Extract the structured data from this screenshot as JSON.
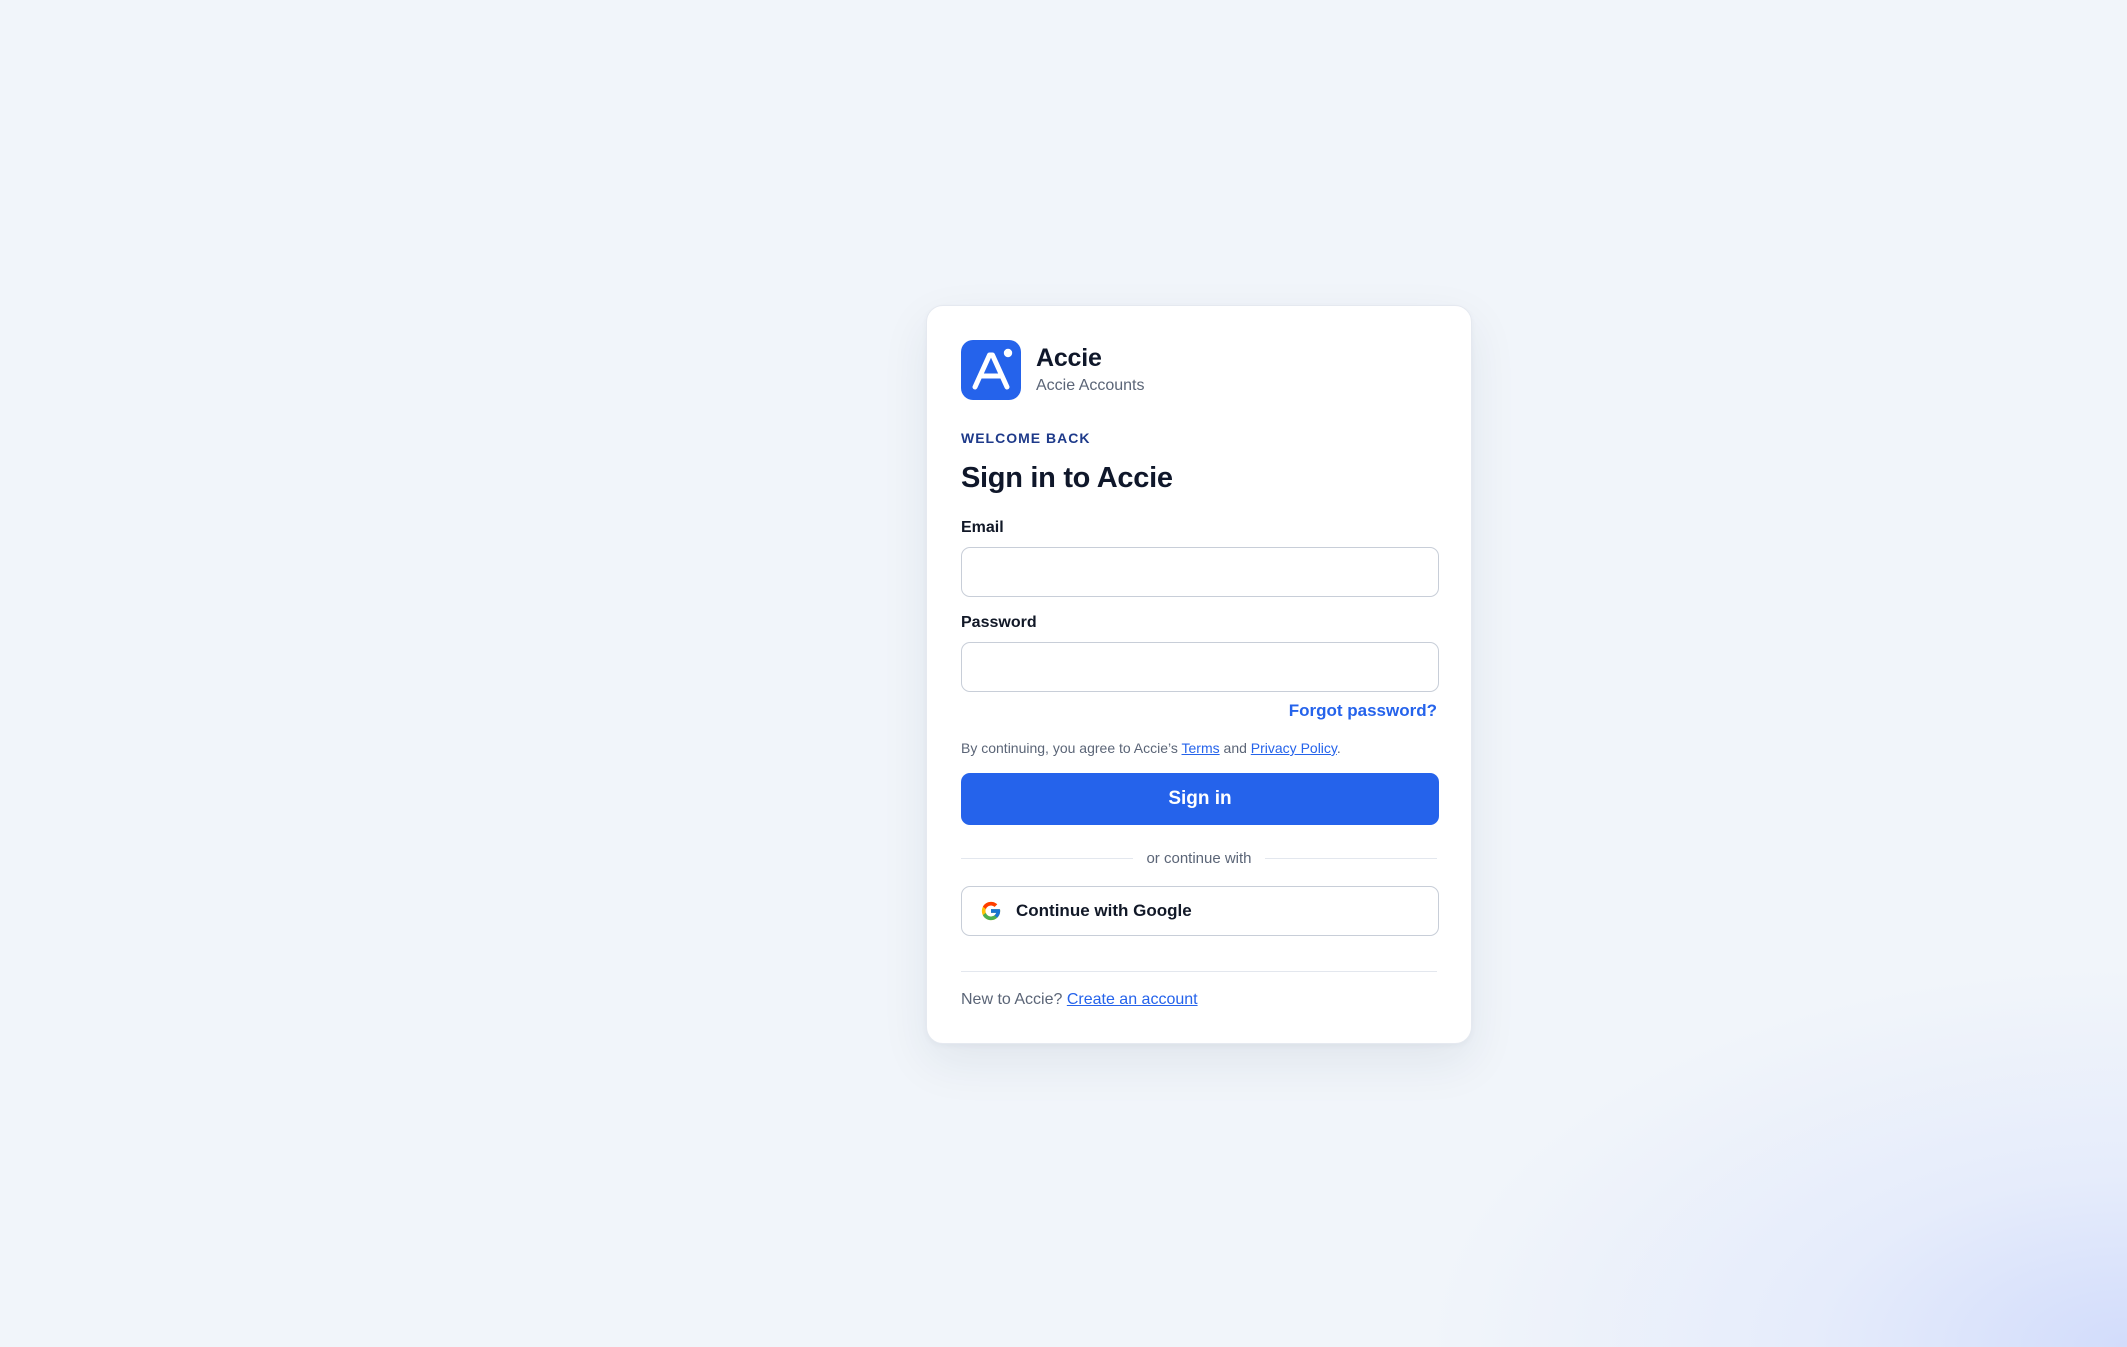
{
  "brand": {
    "logo_icon": "accie-logo-icon",
    "name": "Accie",
    "subtitle": "Accie Accounts",
    "color": "#2563eb"
  },
  "header": {
    "eyebrow": "WELCOME BACK",
    "title": "Sign in to Accie"
  },
  "form": {
    "email": {
      "label": "Email",
      "value": "",
      "placeholder": ""
    },
    "password": {
      "label": "Password",
      "value": "",
      "placeholder": ""
    },
    "forgot_password": "Forgot password?",
    "legal": {
      "prefix": "By continuing, you agree to Accie’s ",
      "terms": "Terms",
      "conjunction": " and ",
      "privacy": "Privacy Policy",
      "suffix": "."
    },
    "submit_label": "Sign in"
  },
  "divider_text": "or continue with",
  "social": {
    "google_label": "Continue with Google",
    "google_icon": "google-icon"
  },
  "footer": {
    "prompt": "New to Accie? ",
    "link": "Create an account"
  }
}
